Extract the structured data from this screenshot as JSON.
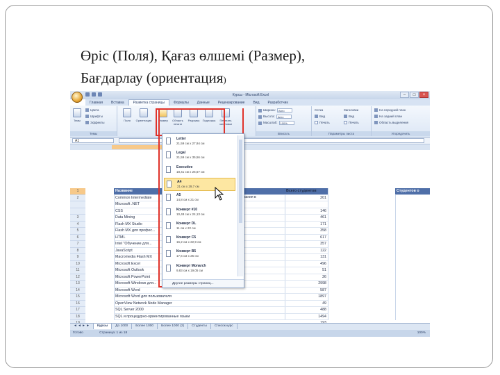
{
  "slide": {
    "title_line1": "Өріс (Поля), Қағаз өлшемі (Размер),",
    "title_line2": "Бағдарлау (ориентация",
    "title_paren": ")"
  },
  "excel": {
    "window_title": "Курсы - Microsoft Excel",
    "tabs": [
      "Главная",
      "Вставка",
      "Разметка страницы",
      "Формулы",
      "Данные",
      "Рецензирование",
      "Вид",
      "Разработчик"
    ],
    "active_tab": "Разметка страницы",
    "ribbon": {
      "themes_group": "Темы",
      "themes_btn": "Темы",
      "colors": "Цвета",
      "fonts": "Шрифты",
      "effects": "Эффекты",
      "margins": "Поля",
      "orientation": "Ориентация",
      "size": "Размер",
      "print_area": "Область печати",
      "breaks": "Разрывы",
      "background": "Подложка",
      "print_titles": "Печатать заголовки",
      "width_label": "Ширина:",
      "width_value": "Авто",
      "height_label": "Высота:",
      "height_value": "Авто",
      "scale_label": "Масштаб:",
      "scale_value": "100%",
      "fit_group": "Вписать",
      "gridlines": "Сетка",
      "headings": "Заголовки",
      "view1": "Вид",
      "view2": "Вид",
      "print1": "Печать",
      "print2": "Печать",
      "sheet_options_group": "Параметры листа",
      "bring_forward": "На передний план",
      "send_backward": "На задний план",
      "selection_pane": "Область выделения",
      "arrange_group": "Упорядочить"
    },
    "name_box": "A1",
    "paper_sizes": [
      {
        "name": "Letter",
        "dims": "21,59 см x 27,94 см"
      },
      {
        "name": "Legal",
        "dims": "21,59 см x 35,56 см"
      },
      {
        "name": "Executive",
        "dims": "18,41 см x 26,67 см"
      },
      {
        "name": "A4",
        "dims": "21 см x 29,7 см"
      },
      {
        "name": "A5",
        "dims": "14,8 см x 21 см"
      },
      {
        "name": "Конверт #10",
        "dims": "10,48 см x 24,13 см"
      },
      {
        "name": "Конверт DL",
        "dims": "11 см x 22 см"
      },
      {
        "name": "Конверт C5",
        "dims": "16,2 см x 22,9 см"
      },
      {
        "name": "Конверт B5",
        "dims": "17,6 см x 25 см"
      },
      {
        "name": "Конверт Monarch",
        "dims": "9,83 см x 19,05 см"
      }
    ],
    "selected_paper": "A4",
    "more_sizes": "Другие размеры страниц...",
    "row_numbers": [
      "1",
      "2",
      "",
      "",
      "3",
      "4",
      "5",
      "6",
      "7",
      "8",
      "9",
      "10",
      "11",
      "12",
      "13",
      "14",
      "15",
      "16",
      "17",
      "18",
      "19",
      "20"
    ],
    "column_header_name": "Название",
    "column_header_count": "Всего студентов",
    "column_header_right": "Студентов о",
    "partial_header": "...ования в",
    "rows": [
      {
        "name": "Common Intermediate",
        "count": "201"
      },
      {
        "name": "Microsoft .NET",
        "count": ""
      },
      {
        "name": "CSS",
        "count": "146"
      },
      {
        "name": "Data Mining",
        "count": "461"
      },
      {
        "name": "Flash MX Studio",
        "count": "171"
      },
      {
        "name": "Flash MX для профес...",
        "count": "358"
      },
      {
        "name": "HTML",
        "count": "617"
      },
      {
        "name": "Intel \"Обучение для...",
        "count": "357"
      },
      {
        "name": "JavaScript",
        "count": "122"
      },
      {
        "name": "Macromedia Flash MX",
        "count": "131"
      },
      {
        "name": "Microsoft Excel",
        "count": "496"
      },
      {
        "name": "Microsoft Outlook",
        "count": "51"
      },
      {
        "name": "Microsoft PowerPoint",
        "count": "26"
      },
      {
        "name": "Microsoft Windows для...",
        "count": "2998"
      },
      {
        "name": "Microsoft Word",
        "count": "587"
      },
      {
        "name": "Microsoft Word для пользователя",
        "count": "1897"
      },
      {
        "name": "OpenView Network Node Manager",
        "count": "49"
      },
      {
        "name": "SQL Server 2000",
        "count": "488"
      },
      {
        "name": "SQL и процедурно-ориентированные языки",
        "count": "1494"
      },
      {
        "name": "...",
        "count": "193"
      }
    ],
    "sheet_tabs": [
      "Курсы",
      "До 1000",
      "Более 1000",
      "Более 1000 (2)",
      "Студенты",
      "Список курс"
    ],
    "active_sheet": "Курсы",
    "status_ready": "Готово",
    "status_page": "Страница: 1 из 18",
    "zoom": "100%"
  },
  "colors": {
    "highlight": "#e0322a",
    "header_blue": "#4f6fa8",
    "selected": "#fde7a2"
  }
}
